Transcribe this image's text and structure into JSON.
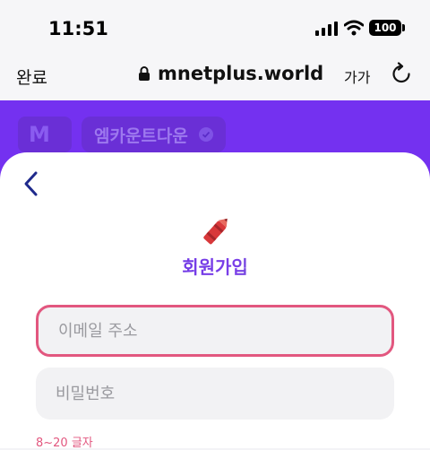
{
  "status_bar": {
    "time": "11:51",
    "battery": "100"
  },
  "browser": {
    "done_label": "완료",
    "url": "mnetplus.world",
    "text_size_label": "가가"
  },
  "background_page": {
    "logo_text": "M",
    "chip_label": "엠카운트다운"
  },
  "signup": {
    "title": "회원가입",
    "email_placeholder": "이메일 주소",
    "password_placeholder": "비밀번호",
    "password_hint": "8~20 글자"
  },
  "colors": {
    "accent_purple": "#7431f0",
    "focus_pink": "#e2577f",
    "title_green": "#3fbf6a"
  },
  "icons": [
    "signal-icon",
    "wifi-icon",
    "battery-icon",
    "lock-icon",
    "reload-icon",
    "check-icon",
    "back-chevron-icon",
    "crayon-icon"
  ]
}
